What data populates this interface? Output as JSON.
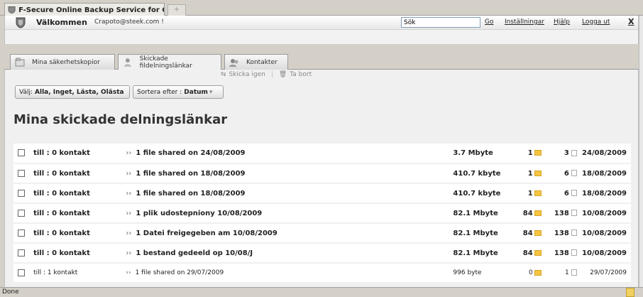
{
  "browser": {
    "tab_title": "F-Secure Online Backup Service for C...",
    "new_tab_symbol": "+",
    "status_text": "Done"
  },
  "welcome": {
    "title": "Välkommen",
    "user": "Crapoto@steek.com !",
    "search_value": "Sök",
    "go_label": "Go",
    "settings_label": "Inställningar",
    "help_label": "Hjälp",
    "logout_label": "Logga ut",
    "close_label": "X"
  },
  "tabs": [
    {
      "label": "Mina säkerhetskopior",
      "icon": "folder-icon"
    },
    {
      "label": "Skickade fildelningslänkar",
      "icon": "share-user-icon"
    },
    {
      "label": "Kontakter",
      "icon": "contacts-icon"
    }
  ],
  "toolbar": {
    "resend_label": "Skicka igen",
    "delete_label": "Ta bort",
    "select_prefix": "Välj:",
    "select_options": "Alla, Inget, Lästa, Olästa",
    "sort_prefix": "Sortera efter :",
    "sort_value": "Datum"
  },
  "page_title": "Mina skickade delningslänkar",
  "rows": [
    {
      "to": "till : 0 kontakt",
      "subject": "1 file shared on 24/08/2009",
      "size": "3.7 Mbyte",
      "folders": "1",
      "files": "3",
      "date": "24/08/2009"
    },
    {
      "to": "till : 0 kontakt",
      "subject": "1 file shared on 18/08/2009",
      "size": "410.7 kbyte",
      "folders": "1",
      "files": "6",
      "date": "18/08/2009"
    },
    {
      "to": "till : 0 kontakt",
      "subject": "1 file shared on 18/08/2009",
      "size": "410.7 kbyte",
      "folders": "1",
      "files": "6",
      "date": "18/08/2009"
    },
    {
      "to": "till : 0 kontakt",
      "subject": "1 plik udostepniony 10/08/2009",
      "size": "82.1 Mbyte",
      "folders": "84",
      "files": "138",
      "date": "10/08/2009"
    },
    {
      "to": "till : 0 kontakt",
      "subject": "1 Datei freigegeben am 10/08/2009",
      "size": "82.1 Mbyte",
      "folders": "84",
      "files": "138",
      "date": "10/08/2009"
    },
    {
      "to": "till : 0 kontakt",
      "subject": "1 bestand gedeeld op 10/08/J",
      "size": "82.1 Mbyte",
      "folders": "84",
      "files": "138",
      "date": "10/08/2009"
    },
    {
      "to": "till : 1 kontakt",
      "subject": "1 file shared on 29/07/2009",
      "size": "996 byte",
      "folders": "0",
      "files": "1",
      "date": "29/07/2009"
    }
  ]
}
